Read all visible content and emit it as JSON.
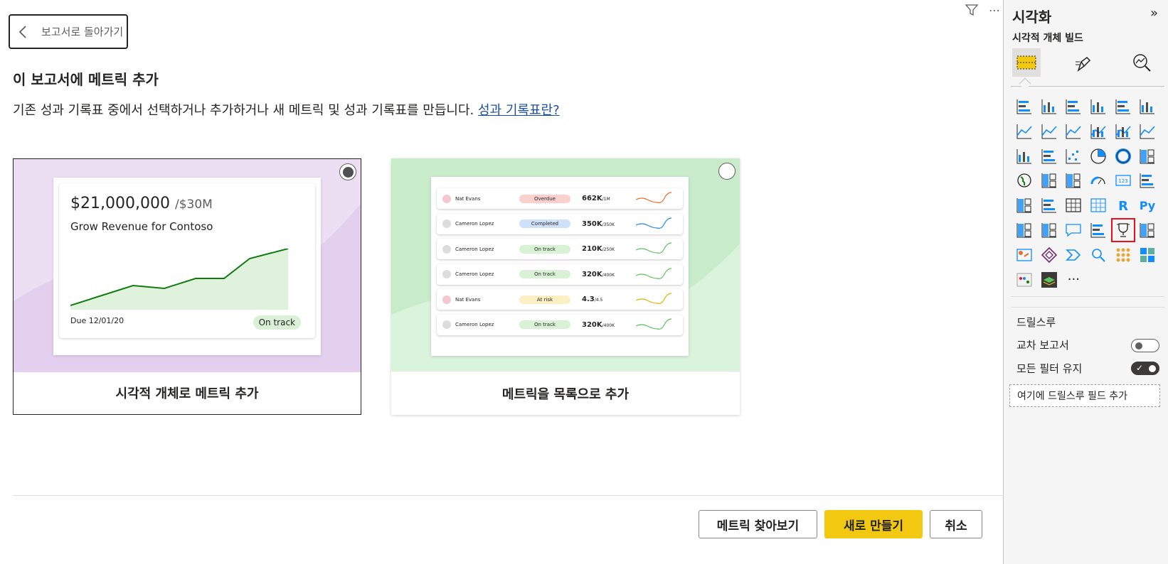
{
  "back_button": {
    "label": "보고서로 돌아가기"
  },
  "heading": "이 보고서에 메트릭 추가",
  "description": {
    "text": "기존 성과 기록표 중에서 선택하거나 추가하거나 새 메트릭 및 성과 기록표를 만듭니다.",
    "link": "성과 기록표란?"
  },
  "card_visual": {
    "label": "시각적 개체로 메트릭 추가",
    "selected": true,
    "preview": {
      "amount": "$21,000,000",
      "target": "/$30M",
      "goal_name": "Grow Revenue for Contoso",
      "due": "Due 12/01/20",
      "status": "On track"
    }
  },
  "card_list": {
    "label": "메트릭을 목록으로 추가",
    "selected": false,
    "rows": [
      {
        "name": "Nat Evans",
        "status": "Overdue",
        "value": "662K",
        "target": "/1M",
        "dot": "#f4c6d0",
        "pill": "#fad1cc",
        "line": "#e8702a"
      },
      {
        "name": "Cameron Lopez",
        "status": "Completed",
        "value": "350K",
        "target": "/350K",
        "dot": "#dcdcdc",
        "pill": "#cfe0fb",
        "line": "#2b88d8"
      },
      {
        "name": "Cameron Lopez",
        "status": "On track",
        "value": "210K",
        "target": "/250K",
        "dot": "#dcdcdc",
        "pill": "#d9f2d6",
        "line": "#5cc45c"
      },
      {
        "name": "Cameron Lopez",
        "status": "On track",
        "value": "320K",
        "target": "/400K",
        "dot": "#dcdcdc",
        "pill": "#d9f2d6",
        "line": "#5cc45c"
      },
      {
        "name": "Nat Evans",
        "status": "At risk",
        "value": "4.3",
        "target": "/4.5",
        "dot": "#f4c6d0",
        "pill": "#fbefc4",
        "line": "#e0b400"
      },
      {
        "name": "Cameron Lopez",
        "status": "On track",
        "value": "320K",
        "target": "/400K",
        "dot": "#dcdcdc",
        "pill": "#d9f2d6",
        "line": "#5cc45c"
      }
    ]
  },
  "footer": {
    "browse": "메트릭 찾아보기",
    "create": "새로 만들기",
    "cancel": "취소"
  },
  "pane": {
    "title": "시각화",
    "subtitle": "시각적 개체 빌드",
    "drill_title": "드릴스루",
    "cross_report": "교차 보고서",
    "keep_filters": "모든 필터 유지",
    "drop_field": "여기에 드릴스루 필드 추가",
    "more": "···"
  },
  "colors": {
    "accent": "#f2c811",
    "link": "#1a4fa0",
    "selection": "#e81123"
  }
}
